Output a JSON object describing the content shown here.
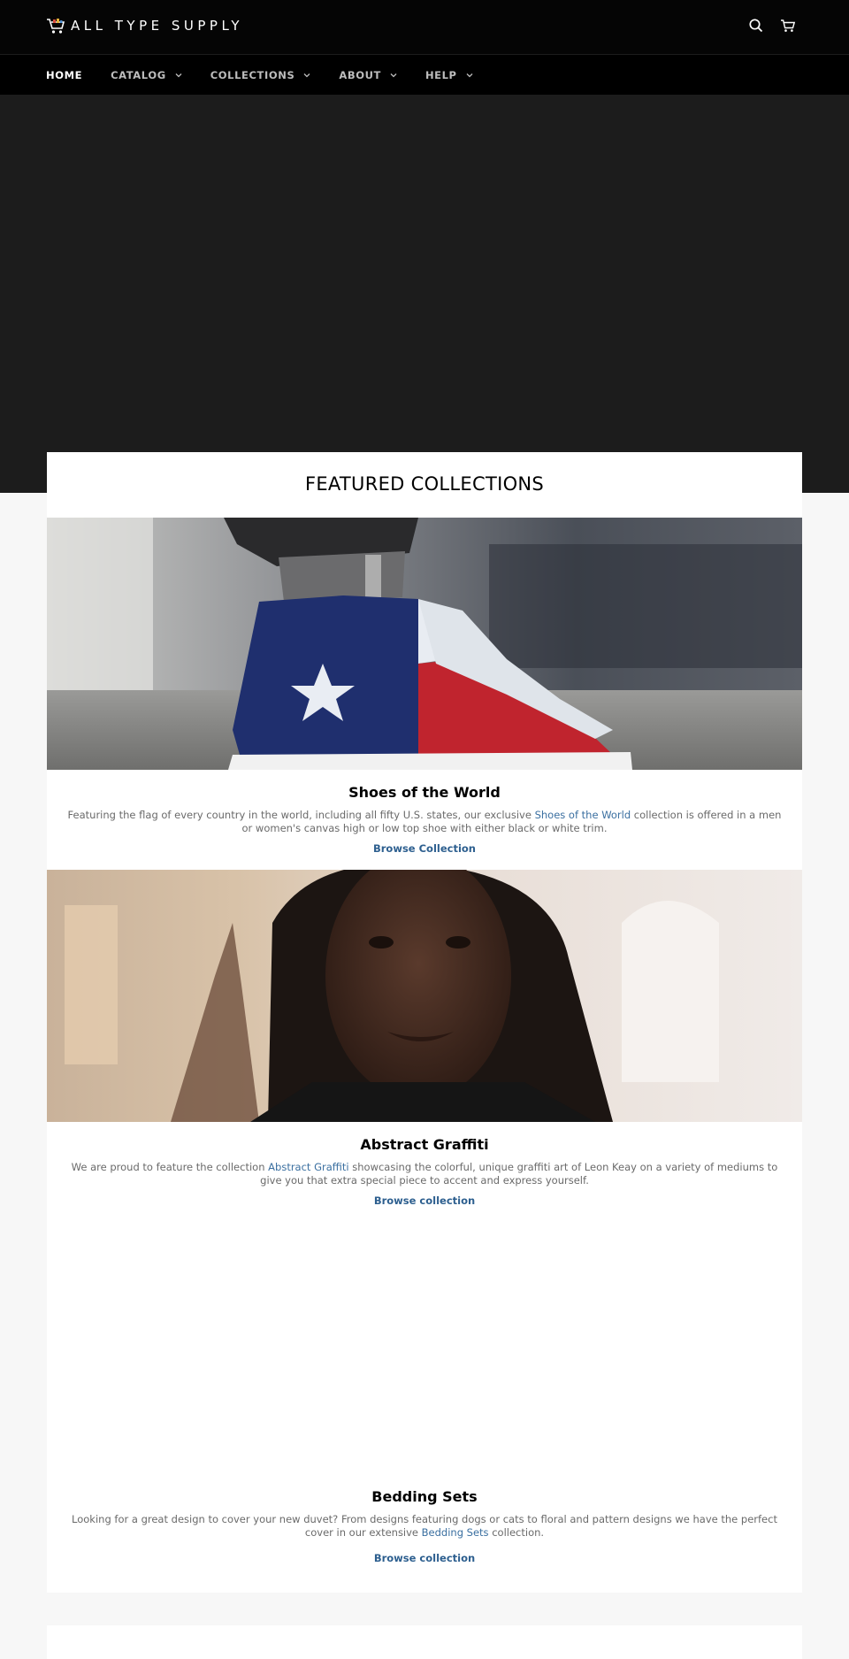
{
  "header": {
    "logo_text": "ALL TYPE SUPPLY",
    "icons": [
      "shopping-cart-logo-icon",
      "search-icon",
      "cart-icon"
    ]
  },
  "nav": {
    "items": [
      {
        "label": "HOME",
        "active": true
      },
      {
        "label": "CATALOG",
        "dropdown": true
      },
      {
        "label": "COLLECTIONS",
        "dropdown": true
      },
      {
        "label": "ABOUT",
        "dropdown": true
      },
      {
        "label": "HELP",
        "dropdown": true
      }
    ]
  },
  "featured": {
    "title": "FEATURED COLLECTIONS",
    "items": [
      {
        "title": "Shoes of the World",
        "desc_before": "Featuring the flag of every country in the world, including all fifty U.S. states, our exclusive ",
        "desc_link": "Shoes of the World",
        "desc_after": " collection is offered in a men or women's canvas high or low top shoe with either black or white trim.",
        "cta": "Browse Collection"
      },
      {
        "title": "Abstract Graffiti",
        "desc_before": "We are proud to feature the collection ",
        "desc_link": "Abstract Graffiti",
        "desc_after": " showcasing the colorful, unique graffiti art of Leon Keay on a variety of mediums to give you that extra special piece to accent and express yourself.",
        "cta": "Browse collection"
      },
      {
        "title": "Bedding Sets",
        "desc_before": "Looking for a great design to cover your new duvet? From designs featuring dogs or cats to floral and pattern designs we have the perfect cover in our extensive ",
        "desc_link": "Bedding Sets",
        "desc_after": " collection.",
        "cta": "Browse collection"
      }
    ]
  },
  "colors": {
    "header_bg": "#050505",
    "hero_bg": "#1c1c1c",
    "link": "#3a6fa0",
    "page_bg": "#f7f7f7"
  }
}
